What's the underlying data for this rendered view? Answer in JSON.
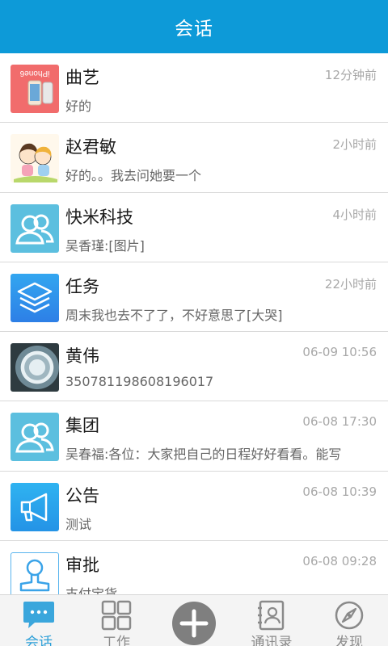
{
  "header": {
    "title": "会话"
  },
  "conversations": [
    {
      "name": "曲艺",
      "time": "12分钟前",
      "preview": "好的",
      "avatar": "phone-photo",
      "avatar_text": "iPhone6"
    },
    {
      "name": "赵君敏",
      "time": "2小时前",
      "preview": "好的。。我去问她要一个",
      "avatar": "kids-photo"
    },
    {
      "name": "快米科技",
      "time": "4小时前",
      "preview": "吴香瑾:[图片]",
      "avatar": "group-icon"
    },
    {
      "name": "任务",
      "time": "22小时前",
      "preview": "周末我也去不了了，不好意思了[大哭]",
      "avatar": "layers-icon"
    },
    {
      "name": "黄伟",
      "time": "06-09 10:56",
      "preview": "350781198608196017",
      "avatar": "crystal-photo"
    },
    {
      "name": "集团",
      "time": "06-08 17:30",
      "preview": "吴春福:各位：大家把自己的日程好好看看。能写",
      "avatar": "group-icon"
    },
    {
      "name": "公告",
      "time": "06-08 10:39",
      "preview": "测试",
      "avatar": "megaphone-icon"
    },
    {
      "name": "审批",
      "time": "06-08 09:28",
      "preview": "支付宝货",
      "avatar": "approval-stamp-icon"
    }
  ],
  "tabbar": {
    "tabs": [
      {
        "label": "会话",
        "icon": "chat-bubble-icon",
        "active": true
      },
      {
        "label": "工作",
        "icon": "grid-icon",
        "active": false
      },
      {
        "label": "",
        "icon": "plus-icon",
        "active": false
      },
      {
        "label": "通讯录",
        "icon": "contacts-book-icon",
        "active": false
      },
      {
        "label": "发现",
        "icon": "compass-icon",
        "active": false
      }
    ]
  },
  "colors": {
    "header": "#0d9ad8",
    "active_tab": "#2b9fd8",
    "time_text": "#a8a8a8"
  }
}
